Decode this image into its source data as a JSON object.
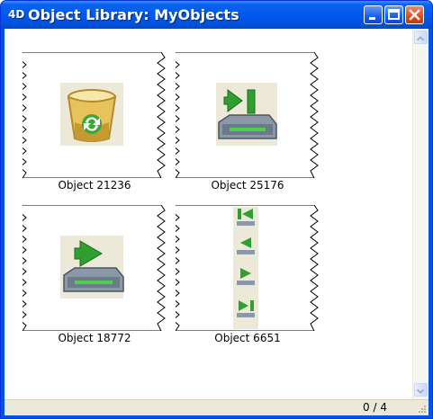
{
  "window": {
    "app_icon": "4D",
    "title": "Object Library: MyObjects",
    "controls": [
      "minimize-icon",
      "maximize-icon",
      "close-icon"
    ]
  },
  "objects": [
    {
      "label": "Object 21236",
      "icon": "trash-refresh-icon"
    },
    {
      "label": "Object 25176",
      "icon": "tray-last-icon"
    },
    {
      "label": "Object 18772",
      "icon": "tray-next-icon"
    },
    {
      "label": "Object 6651",
      "icon": "nav-arrows-strip-icon"
    }
  ],
  "status": {
    "counter": "0 / 4"
  },
  "colors": {
    "titlebar": "#0058ee",
    "status_bg": "#ece9d8",
    "close": "#e04a1f"
  }
}
